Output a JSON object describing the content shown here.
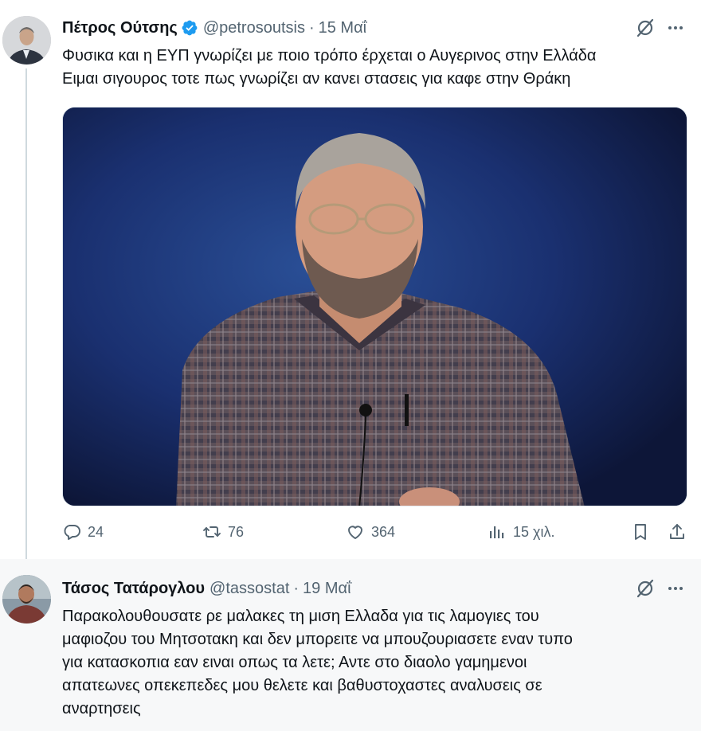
{
  "tweets": [
    {
      "author_name": "Πέτρος Ούτσης",
      "handle": "@petrosoutsis",
      "date": "15 Μαΐ",
      "text_line1": "Φυσικα και η ΕΥΠ γνωρίζει με ποιο τρόπο έρχεται ο Αυγερινος στην Ελλάδα",
      "text_line2": "Ειμαι σιγουρος τοτε πως γνωρίζει αν κανει στασεις για καφε στην Θράκη",
      "verified": true,
      "actions": {
        "replies": "24",
        "reposts": "76",
        "likes": "364",
        "views": "15 χιλ."
      }
    },
    {
      "author_name": "Τάσος Τατάρογλου",
      "handle": "@tassostat",
      "date": "19 Μαΐ",
      "text_lines": [
        "Παρακολουθουσατε ρε μαλακες τη μιση Ελλαδα για τις λαμογιες του",
        "μαφιοζου του Μητσοτακη και δεν μπορειτε να μπουζουριασετε εναν τυπο",
        "για κατασκοπια εαν ειναι οπως τα λετε; Αντε στο διαολο γαμημενοι",
        "απατεωνες οπεκεπεδες μου θελετε και βαθυστοχαστες αναλυσεις σε",
        "αναρτησεις"
      ]
    }
  ],
  "sep": "·",
  "icons": [
    "grok-icon",
    "more-icon",
    "reply-icon",
    "repost-icon",
    "like-icon",
    "views-icon",
    "bookmark-icon",
    "share-icon",
    "verified-badge-icon"
  ],
  "colors": {
    "verified": "#1d9bf0",
    "muted": "#536471",
    "text": "#0f1419"
  }
}
